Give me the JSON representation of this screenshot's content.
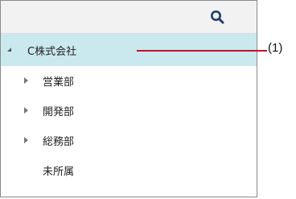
{
  "toolbar": {
    "search_icon": "search-icon"
  },
  "tree": {
    "root": {
      "label": "C株式会社",
      "expanded": true,
      "selected": true,
      "toggle_icon": "caret-down-icon"
    },
    "children": [
      {
        "label": "営業部",
        "expanded": false,
        "toggle_icon": "caret-right-icon"
      },
      {
        "label": "開発部",
        "expanded": false,
        "toggle_icon": "caret-right-icon"
      },
      {
        "label": "総務部",
        "expanded": false,
        "toggle_icon": "caret-right-icon"
      },
      {
        "label": "未所属",
        "expanded": false,
        "toggle_icon": null
      }
    ]
  },
  "annotation": {
    "label": "(1)"
  },
  "colors": {
    "accent_search": "#1f3d6e",
    "selected_row": "#c9e9ee",
    "callout_line": "#c8102e",
    "toolbar_bg": "#f2f2f2"
  }
}
